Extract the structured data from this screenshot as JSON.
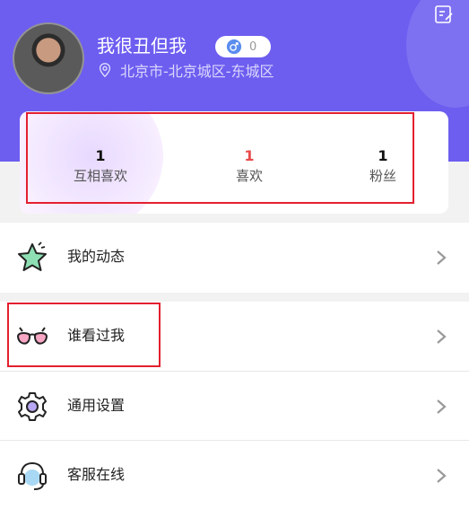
{
  "profile": {
    "username": "我很丑但我",
    "gender_count": "0",
    "location": "北京市-北京城区-东城区"
  },
  "stats": [
    {
      "count": "1",
      "label": "互相喜欢"
    },
    {
      "count": "1",
      "label": "喜欢"
    },
    {
      "count": "1",
      "label": "粉丝"
    }
  ],
  "menu": [
    {
      "label": "我的动态",
      "icon": "star-icon"
    },
    {
      "label": "谁看过我",
      "icon": "glasses-icon"
    },
    {
      "label": "通用设置",
      "icon": "gear-icon"
    },
    {
      "label": "客服在线",
      "icon": "headset-icon"
    }
  ],
  "colors": {
    "header": "#6d5ef0",
    "likes_count": "#e84a4a",
    "highlight": "#e3202f"
  }
}
